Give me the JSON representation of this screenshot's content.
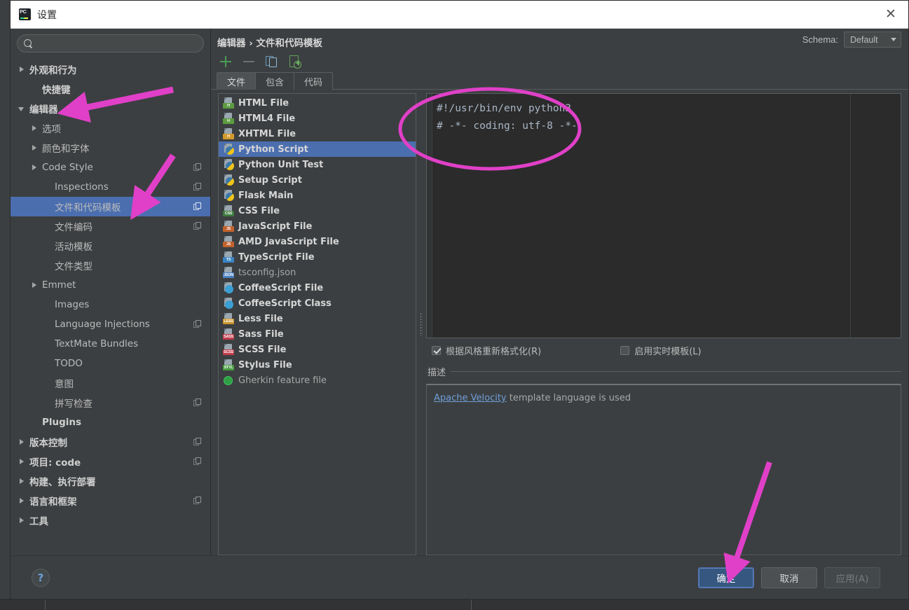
{
  "window": {
    "title": "设置",
    "app_icon": "pycharm-icon",
    "close_label": "✕"
  },
  "search": {
    "placeholder": "",
    "value": "",
    "icon": "search-icon"
  },
  "sidebar": {
    "items": [
      {
        "label": "外观和行为",
        "indent": 0,
        "twisty": "closed",
        "bold": true,
        "selected": false,
        "badge": false
      },
      {
        "label": "快捷键",
        "indent": 1,
        "twisty": "none",
        "bold": true,
        "selected": false,
        "badge": false
      },
      {
        "label": "编辑器",
        "indent": 0,
        "twisty": "open",
        "bold": true,
        "selected": false,
        "badge": false
      },
      {
        "label": "选项",
        "indent": 1,
        "twisty": "closed",
        "bold": false,
        "selected": false,
        "badge": false
      },
      {
        "label": "颜色和字体",
        "indent": 1,
        "twisty": "closed",
        "bold": false,
        "selected": false,
        "badge": false
      },
      {
        "label": "Code Style",
        "indent": 1,
        "twisty": "closed",
        "bold": false,
        "selected": false,
        "badge": true
      },
      {
        "label": "Inspections",
        "indent": 2,
        "twisty": "none",
        "bold": false,
        "selected": false,
        "badge": true
      },
      {
        "label": "文件和代码模板",
        "indent": 2,
        "twisty": "none",
        "bold": false,
        "selected": true,
        "badge": true
      },
      {
        "label": "文件编码",
        "indent": 2,
        "twisty": "none",
        "bold": false,
        "selected": false,
        "badge": true
      },
      {
        "label": "活动模板",
        "indent": 2,
        "twisty": "none",
        "bold": false,
        "selected": false,
        "badge": false
      },
      {
        "label": "文件类型",
        "indent": 2,
        "twisty": "none",
        "bold": false,
        "selected": false,
        "badge": false
      },
      {
        "label": "Emmet",
        "indent": 1,
        "twisty": "closed",
        "bold": false,
        "selected": false,
        "badge": false
      },
      {
        "label": "Images",
        "indent": 2,
        "twisty": "none",
        "bold": false,
        "selected": false,
        "badge": false
      },
      {
        "label": "Language Injections",
        "indent": 2,
        "twisty": "none",
        "bold": false,
        "selected": false,
        "badge": true
      },
      {
        "label": "TextMate Bundles",
        "indent": 2,
        "twisty": "none",
        "bold": false,
        "selected": false,
        "badge": false
      },
      {
        "label": "TODO",
        "indent": 2,
        "twisty": "none",
        "bold": false,
        "selected": false,
        "badge": false
      },
      {
        "label": "意图",
        "indent": 2,
        "twisty": "none",
        "bold": false,
        "selected": false,
        "badge": false
      },
      {
        "label": "拼写检查",
        "indent": 2,
        "twisty": "none",
        "bold": false,
        "selected": false,
        "badge": true
      },
      {
        "label": "Plugins",
        "indent": 1,
        "twisty": "none",
        "bold": true,
        "selected": false,
        "badge": false
      },
      {
        "label": "版本控制",
        "indent": 0,
        "twisty": "closed",
        "bold": true,
        "selected": false,
        "badge": true
      },
      {
        "label": "项目: code",
        "indent": 0,
        "twisty": "closed",
        "bold": true,
        "selected": false,
        "badge": true
      },
      {
        "label": "构建、执行部署",
        "indent": 0,
        "twisty": "closed",
        "bold": true,
        "selected": false,
        "badge": false
      },
      {
        "label": "语言和框架",
        "indent": 0,
        "twisty": "closed",
        "bold": true,
        "selected": false,
        "badge": true
      },
      {
        "label": "工具",
        "indent": 0,
        "twisty": "closed",
        "bold": true,
        "selected": false,
        "badge": false
      }
    ]
  },
  "content": {
    "breadcrumb": "编辑器 › 文件和代码模板",
    "schema": {
      "label": "Schema:",
      "value": "Default",
      "caret_icon": "chevron-down-icon"
    },
    "toolbar": [
      {
        "name": "add-template-button",
        "icon": "plus-icon"
      },
      {
        "name": "remove-template-button",
        "icon": "minus-icon"
      },
      {
        "name": "copy-template-button",
        "icon": "copy-icon"
      },
      {
        "name": "reset-template-button",
        "icon": "reset-icon"
      }
    ],
    "tabs": [
      {
        "label": "文件",
        "active": true
      },
      {
        "label": "包含",
        "active": false
      },
      {
        "label": "代码",
        "active": false
      }
    ]
  },
  "templates": [
    {
      "label": "HTML File",
      "icon": "html-file-icon",
      "selected": false,
      "dim": false
    },
    {
      "label": "HTML4 File",
      "icon": "html4-file-icon",
      "selected": false,
      "dim": false
    },
    {
      "label": "XHTML File",
      "icon": "xhtml-file-icon",
      "selected": false,
      "dim": false
    },
    {
      "label": "Python Script",
      "icon": "python-file-icon",
      "selected": true,
      "dim": false
    },
    {
      "label": "Python Unit Test",
      "icon": "python-file-icon",
      "selected": false,
      "dim": false
    },
    {
      "label": "Setup Script",
      "icon": "python-file-icon",
      "selected": false,
      "dim": false
    },
    {
      "label": "Flask Main",
      "icon": "python-file-icon",
      "selected": false,
      "dim": false
    },
    {
      "label": "CSS File",
      "icon": "css-file-icon",
      "selected": false,
      "dim": false
    },
    {
      "label": "JavaScript File",
      "icon": "js-file-icon",
      "selected": false,
      "dim": false
    },
    {
      "label": "AMD JavaScript File",
      "icon": "js-file-icon",
      "selected": false,
      "dim": false
    },
    {
      "label": "TypeScript File",
      "icon": "ts-file-icon",
      "selected": false,
      "dim": false
    },
    {
      "label": "tsconfig.json",
      "icon": "json-file-icon",
      "selected": false,
      "dim": true
    },
    {
      "label": "CoffeeScript File",
      "icon": "coffeescript-file-icon",
      "selected": false,
      "dim": false
    },
    {
      "label": "CoffeeScript Class",
      "icon": "coffeescript-file-icon",
      "selected": false,
      "dim": false
    },
    {
      "label": "Less File",
      "icon": "less-file-icon",
      "selected": false,
      "dim": false
    },
    {
      "label": "Sass File",
      "icon": "sass-file-icon",
      "selected": false,
      "dim": false
    },
    {
      "label": "SCSS File",
      "icon": "scss-file-icon",
      "selected": false,
      "dim": false
    },
    {
      "label": "Stylus File",
      "icon": "stylus-file-icon",
      "selected": false,
      "dim": false
    },
    {
      "label": "Gherkin feature file",
      "icon": "gherkin-file-icon",
      "selected": false,
      "dim": true
    }
  ],
  "editor": {
    "lines": [
      "#!/usr/bin/env python3",
      "# -*- coding: utf-8 -*-"
    ]
  },
  "options": {
    "reformat": {
      "label": "根据风格重新格式化(R)",
      "checked": true
    },
    "live_template": {
      "label": "启用实时模板(L)",
      "checked": false
    }
  },
  "description": {
    "legend": "描述",
    "link_text": "Apache Velocity",
    "rest_text": " template language is used"
  },
  "footer": {
    "help_label": "?",
    "ok_label": "确定",
    "cancel_label": "取消",
    "apply_label": "应用(A)"
  },
  "colors": {
    "selection_blue": "#4b6eaf",
    "panel_bg": "#3c3f41",
    "editor_bg": "#2b2b2b",
    "accent_pink": "#e040c8",
    "link_blue": "#6f9fd8",
    "primary_button": "#365880"
  },
  "annotations": [
    {
      "name": "arrow-to-editor-node",
      "type": "arrow"
    },
    {
      "name": "arrow-to-templates-node",
      "type": "arrow"
    },
    {
      "name": "ellipse-around-code",
      "type": "ellipse"
    },
    {
      "name": "arrow-to-ok-button",
      "type": "arrow"
    }
  ]
}
